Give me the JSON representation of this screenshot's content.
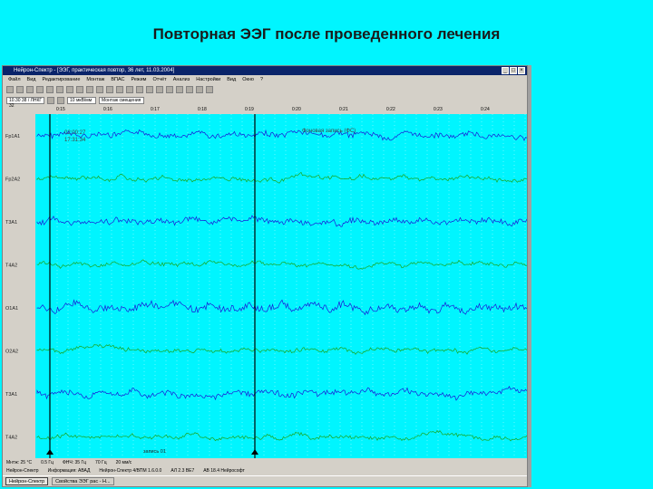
{
  "slide": {
    "title": "Повторная ЭЭГ после проведенного лечения"
  },
  "window": {
    "title": "Нейрон-Спектр - [ЭЭГ, практическая повтор, 36 лет, 11.03.2004]",
    "controls": [
      "_",
      "□",
      "×"
    ]
  },
  "menu": [
    "Файл",
    "Вид",
    "Редактирование",
    "Монтаж",
    "ВПАС",
    "Режим",
    "Отчёт",
    "Анализ",
    "Настройки",
    "Вид",
    "Окно",
    "?"
  ],
  "toolbar2": {
    "combo1": "10.30 38 / ЛНКГ 32",
    "combo2": "10 мкВ/мм",
    "combo3": "Монтаж смещения"
  },
  "eeg": {
    "channels": [
      "Fp1A1",
      "Fp2A2",
      "T3A1",
      "T4A2",
      "O1A1",
      "O2A2",
      "T3A1",
      "T4A2"
    ],
    "time_marks": [
      "0:15",
      "0:16",
      "0:17",
      "0:18",
      "0:19",
      "0:20",
      "0:21",
      "0:22",
      "0:23",
      "0:24"
    ],
    "annotation_left": "02:00:27\n17:31:34",
    "annotation_right": "Фоновая запись (ФС)",
    "bottom_marker": "запись 01",
    "trace_colors": [
      "#1a1ad8",
      "#1aa51a"
    ]
  },
  "status": {
    "line1": [
      "Мнтж: 25 °C",
      "0.5 Гц",
      "ФНЧ: 35 Гц",
      "70 Гц",
      "20 мм/с"
    ],
    "line2": [
      "Нейрон-Спектр",
      "Информация: АВАД",
      "Нейрон-Спектр 4/ВПМ 1.6.0.0",
      "АЛ 2.3 ВЕ7",
      "АВ 18.4 Нейрософт"
    ]
  },
  "taskbar": {
    "items": [
      "Нейрон-Спектр",
      "Свойства ЭЭГ рас - Н..."
    ]
  }
}
